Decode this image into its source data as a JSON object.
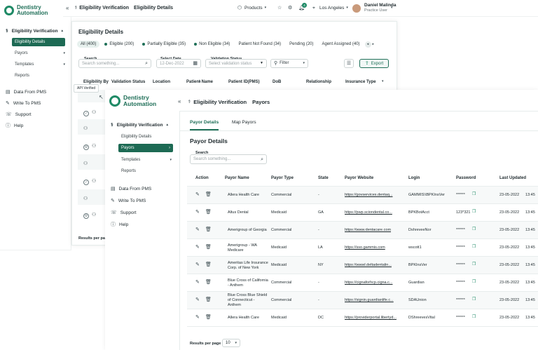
{
  "app": {
    "brand_line1": "Dentistry",
    "brand_line2": "Automation"
  },
  "header": {
    "collapse_glyph": "«",
    "breadcrumb_root": "Eligibility Verification",
    "breadcrumb_page": "Eligibility Details",
    "products_label": "Products",
    "location_label": "Los Angeles",
    "user_name": "Daniel Malinda",
    "user_role": "Practice User",
    "notification_count": "4"
  },
  "sidebar": {
    "eligibility_verification": "Eligibility Verification",
    "eligibility_details": "Eligibility Details",
    "payors": "Payors",
    "templates": "Templates",
    "reports": "Reports",
    "data_from_pms": "Data From PMS",
    "write_to_pms": "Write To PMS",
    "support": "Support",
    "help": "Help"
  },
  "eligibility": {
    "title": "Eligibility Details",
    "filters": [
      {
        "label": "All (400)",
        "active": true,
        "dot": false
      },
      {
        "label": "Eligible (200)",
        "dot": true
      },
      {
        "label": "Partially Eligible (35)",
        "dot": true
      },
      {
        "label": "Non Eligible (34)",
        "dot": true
      },
      {
        "label": "Patient Not Found (34)",
        "dot": false
      },
      {
        "label": "Pending (20)",
        "dot": false
      },
      {
        "label": "Agent Assigned (40)",
        "dot": false
      }
    ],
    "search_label": "Search",
    "search_placeholder": "Search something...",
    "date_label": "Select Date",
    "date_value": "12-Dec-2022",
    "status_label": "Validation Status",
    "status_placeholder": "Select validation status",
    "filter_label": "Filter",
    "export_label": "Export",
    "columns": [
      "Eligibility By",
      "Validation Status",
      "Location",
      "Patient Name",
      "Patient ID(PMS)",
      "DoB",
      "Relationship",
      "Insurance Type"
    ],
    "tooltip": "API Verified",
    "results_per_page": "Results per page"
  },
  "payors": {
    "breadcrumb_root": "Eligibility Verification",
    "breadcrumb_page": "Payors",
    "tabs": [
      "Payor Details",
      "Map Payors"
    ],
    "title": "Payor Details",
    "search_label": "Search",
    "search_placeholder": "Search something...",
    "columns": [
      "Action",
      "Payor Name",
      "Payor Type",
      "State",
      "Payor Website",
      "Login",
      "Password",
      "Last Updated"
    ],
    "rows": [
      {
        "name": [
          "Allera Health Care"
        ],
        "type": "Commercial",
        "state": "-",
        "website": "https://govservices.dentaq...",
        "login": "GAMMIS\\\\BPKInsVer",
        "password": "******",
        "date": "23-05-2022",
        "time": "13:45"
      },
      {
        "name": [
          "Altus Dental"
        ],
        "type": "Medicaid",
        "state": "GA",
        "website": "https://pwp.sciondental.co...",
        "login": "BPKBotAcct",
        "password": "123*321",
        "date": "23-05-2022",
        "time": "13:45"
      },
      {
        "name": [
          "Amerigroup of Georgia"
        ],
        "type": "Commercial",
        "state": "-",
        "website": "https://www.dentacare.com",
        "login": "DshreveeNor",
        "password": "******",
        "date": "23-05-2022",
        "time": "13:45"
      },
      {
        "name": [
          "Amerigroup - WA",
          "Medicare"
        ],
        "type": "Medicaid",
        "state": "LA",
        "website": "https://sso.gammis.com",
        "login": "wscott1",
        "password": "******",
        "date": "23-05-2022",
        "time": "13:45"
      },
      {
        "name": [
          "Ameritas Life Insurance",
          "Corp. of New York"
        ],
        "type": "Medicaid",
        "state": "NY",
        "website": "https://wwwl.deltadentalin...",
        "login": "BPKInsVer",
        "password": "******",
        "date": "23-05-2022",
        "time": "13:45"
      },
      {
        "name": [
          "Blue Cross of California",
          "- Anthem"
        ],
        "type": "Commercial",
        "state": "-",
        "website": "https://cignaforhcp.cigna.c...",
        "login": "Guardian",
        "password": "******",
        "date": "23-05-2022",
        "time": "13:45"
      },
      {
        "name": [
          "Blue Cross Blue Shield",
          "of Connecticut -",
          "Anthem"
        ],
        "type": "Commercial",
        "state": "-",
        "website": "https://signin.guardianlife.c...",
        "login": "SDAUnion",
        "password": "******",
        "date": "23-05-2022",
        "time": "13:45"
      },
      {
        "name": [
          "Allera Health Care"
        ],
        "type": "Medicaid",
        "state": "DC",
        "website": "https://providerportal.libertyd...",
        "login": "DShreevesVital",
        "password": "******",
        "date": "23-05-2022",
        "time": "13:45"
      }
    ],
    "results_per_page": "Results per page",
    "page_size": "10"
  },
  "colors": {
    "brand": "#1f6f58",
    "accent": "#1f8a66"
  }
}
